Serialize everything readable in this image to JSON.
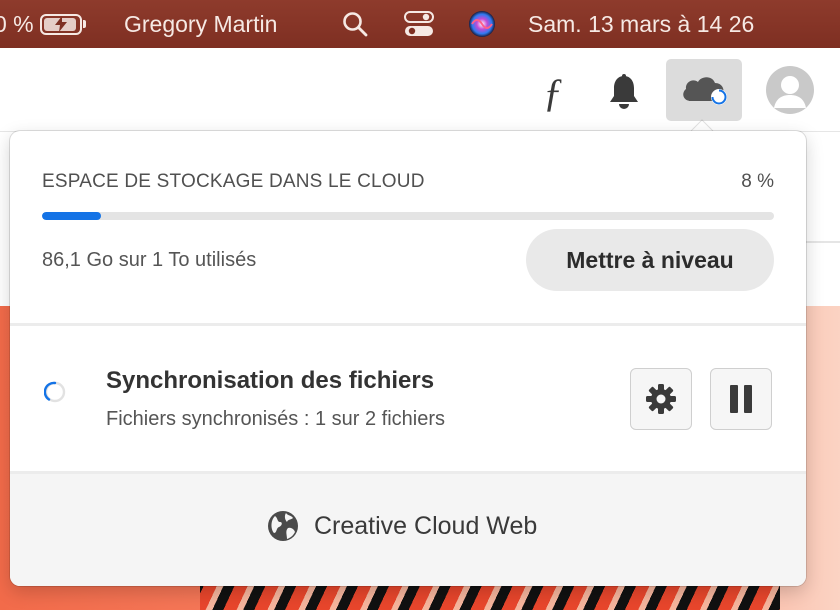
{
  "menubar": {
    "battery_percent": "0 %",
    "user_name": "Gregory Martin",
    "date_time": "Sam. 13 mars à  14 26"
  },
  "toolbar": {
    "font_icon": "ƒ",
    "icons": [
      "fonts-icon",
      "bell-icon",
      "cloud-sync-icon",
      "avatar-icon"
    ]
  },
  "storage": {
    "title": "ESPACE DE STOCKAGE DANS LE CLOUD",
    "percent_label": "8 %",
    "percent_value": 0.08,
    "usage": "86,1 Go sur 1 To utilisés",
    "upgrade_label": "Mettre à niveau"
  },
  "sync": {
    "title": "Synchronisation des fichiers",
    "status": "Fichiers synchronisés : 1 sur 2 fichiers"
  },
  "footer": {
    "link_label": "Creative Cloud Web"
  },
  "colors": {
    "menubar": "#8e3b2c",
    "progress": "#1473e6",
    "button_bg": "#e9e9e9"
  }
}
